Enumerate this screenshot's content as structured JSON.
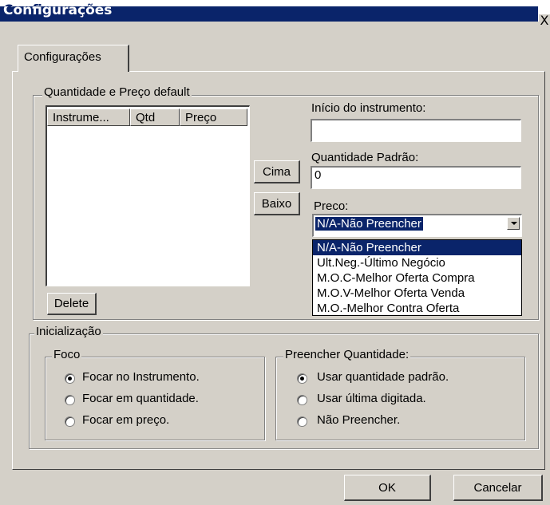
{
  "window": {
    "title": "Configurações",
    "close_glyph": "X"
  },
  "tab": {
    "label": "Configurações"
  },
  "default_group": {
    "legend": "Quantidade e Preço default",
    "columns": [
      "Instrume...",
      "Qtd",
      "Preço"
    ],
    "rows": [],
    "delete_label": "Delete",
    "up_label": "Cima",
    "down_label": "Baixo",
    "instrument_start_label": "Início do instrumento:",
    "instrument_start_value": "",
    "default_quantity_label": "Quantidade Padrão:",
    "default_quantity_value": "0",
    "price_label": "Preco:",
    "price_selected": "N/A-Não Preencher",
    "price_options": [
      "N/A-Não Preencher",
      "Ult.Neg.-Último Negócio",
      "M.O.C-Melhor Oferta Compra",
      "M.O.V-Melhor Oferta Venda",
      "M.O.-Melhor Contra Oferta"
    ]
  },
  "init_group": {
    "legend": "Inicialização",
    "focus": {
      "legend": "Foco",
      "options": [
        "Focar no Instrumento.",
        "Focar em quantidade.",
        "Focar em preço."
      ],
      "selected_index": 0
    },
    "fill_quantity": {
      "legend": "Preencher Quantidade:",
      "options": [
        "Usar quantidade padrão.",
        "Usar última digitada.",
        "Não Preencher."
      ],
      "selected_index": 0
    }
  },
  "footer": {
    "ok_label": "OK",
    "cancel_label": "Cancelar"
  },
  "colors": {
    "face": "#d4d0c8",
    "title_bar": "#0a246a",
    "selection": "#0a246a"
  }
}
